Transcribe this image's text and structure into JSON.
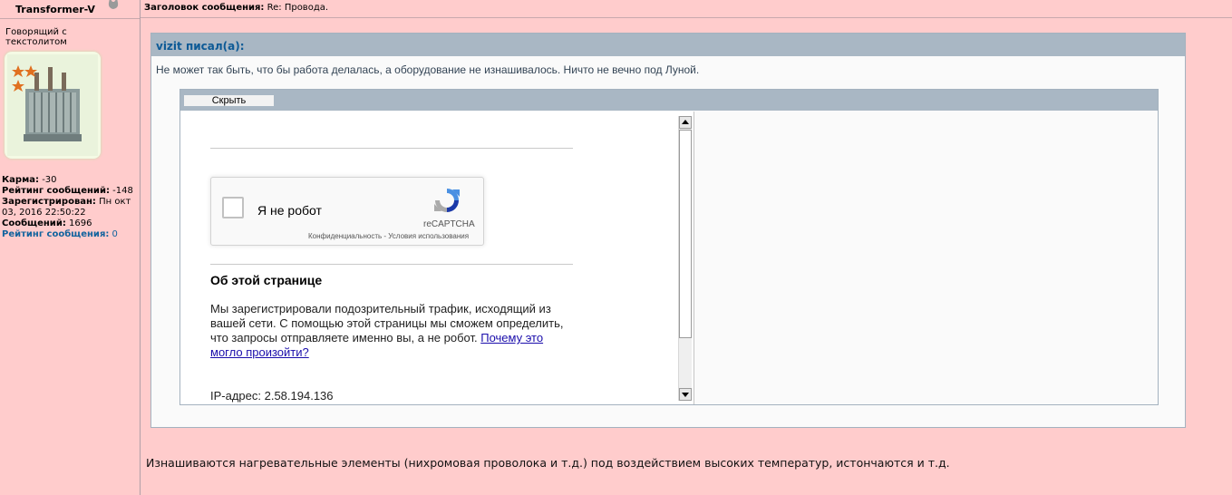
{
  "author": {
    "name": "Transformer-V",
    "rank": "Говорящий с текстолитом",
    "stats": {
      "karma_label": "Карма:",
      "karma_value": "-30",
      "msg_rating_label": "Рейтинг сообщений:",
      "msg_rating_value": "-148",
      "registered_label": "Зарегистрирован:",
      "registered_value": "Пн окт 03, 2016 22:50:22",
      "messages_label": "Сообщений:",
      "messages_value": "1696",
      "post_rating_label": "Рейтинг сообщения:",
      "post_rating_value": "0"
    }
  },
  "post": {
    "subject_label": "Заголовок сообщения:",
    "subject_value": "Re: Провода.",
    "quote_author": "vizit писал(а):",
    "quote_text": "Не может так быть, что бы работа делалась, а оборудование не изнашивалось. Ничто не вечно под Луной.",
    "spoiler_button": "Скрыть",
    "reply_text": "Изнашиваются нагревательные элементы (нихромовая проволока и т.д.) под воздействием высоких температур, истончаются и т.д."
  },
  "captcha": {
    "checkbox_label": "Я не робот",
    "brand": "reCAPTCHA",
    "links": "Конфиденциальность - Условия использования",
    "about_title": "Об этой странице",
    "about_text": "Мы зарегистрировали подозрительный трафик, исходящий из вашей сети. С помощью этой страницы мы сможем определить, что запросы отправляете именно вы, а не робот.",
    "about_link": "Почему это могло произойти?",
    "ip_line": "IP-адрес: 2.58.194.136"
  },
  "colors": {
    "page_bg": "#ffcccc",
    "header_bar": "#a9b7c4",
    "link_blue": "#0d5a96",
    "recaptcha_blue": "#4a90e2"
  }
}
